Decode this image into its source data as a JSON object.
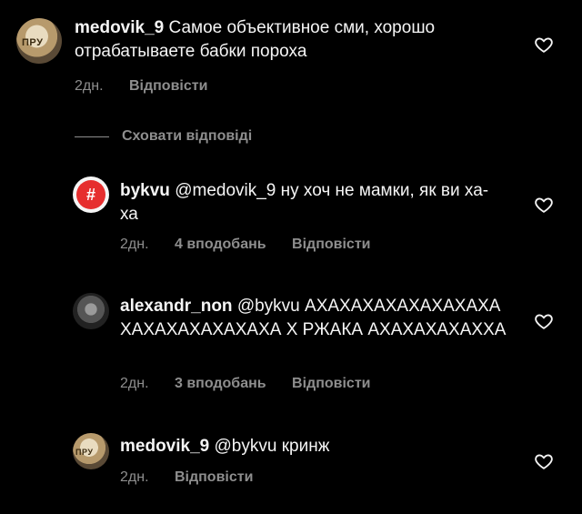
{
  "hide_replies_label": "Сховати відповіді",
  "comments": [
    {
      "username": "medovik_9",
      "text": "Самое объективное сми, хорошо отрабатываете бабки пороха",
      "time": "2дн.",
      "likes": "",
      "reply_label": "Відповісти",
      "avatar_label": "ПРУ"
    },
    {
      "username": "bykvu",
      "mention": "@medovik_9",
      "text": "ну хоч не мамки, як ви ха-ха",
      "time": "2дн.",
      "likes": "4 вподобань",
      "reply_label": "Відповісти",
      "avatar_label": "#"
    },
    {
      "username": "alexandr_non",
      "mention": "@bykvu",
      "text": "АХАХАХАХАХАХАХАХАХАХАХАХАХАХАХА Х РЖАКА АХАХАХАХАХХА",
      "time": "2дн.",
      "likes": "3 вподобань",
      "reply_label": "Відповісти"
    },
    {
      "username": "medovik_9",
      "mention": "@bykvu",
      "text": "кринж",
      "time": "2дн.",
      "likes": "",
      "reply_label": "Відповісти",
      "avatar_label": "ПРУ"
    }
  ],
  "icons": {
    "heart": "heart-outline-icon"
  }
}
